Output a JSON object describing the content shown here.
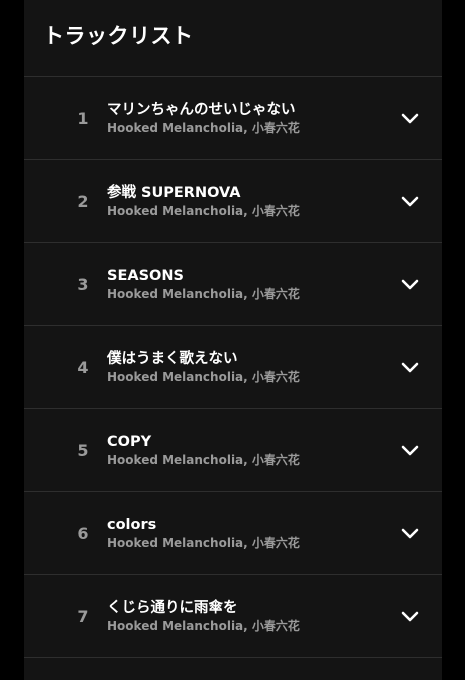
{
  "header": {
    "title": "トラックリスト"
  },
  "tracks": [
    {
      "number": "1",
      "title": "マリンちゃんのせいじゃない",
      "artists": "Hooked Melancholia, 小春六花"
    },
    {
      "number": "2",
      "title": "参戦 SUPERNOVA",
      "artists": "Hooked Melancholia, 小春六花"
    },
    {
      "number": "3",
      "title": "SEASONS",
      "artists": "Hooked Melancholia, 小春六花"
    },
    {
      "number": "4",
      "title": "僕はうまく歌えない",
      "artists": "Hooked Melancholia, 小春六花"
    },
    {
      "number": "5",
      "title": "COPY",
      "artists": "Hooked Melancholia, 小春六花"
    },
    {
      "number": "6",
      "title": "colors",
      "artists": "Hooked Melancholia, 小春六花"
    },
    {
      "number": "7",
      "title": "くじら通りに雨傘を",
      "artists": "Hooked Melancholia, 小春六花"
    }
  ],
  "icons": {
    "expand": "chevron-down-icon"
  },
  "colors": {
    "background": "#000000",
    "panel": "#141414",
    "divider": "#2e2e2e",
    "primary_text": "#ffffff",
    "secondary_text": "#9a9a9a"
  }
}
